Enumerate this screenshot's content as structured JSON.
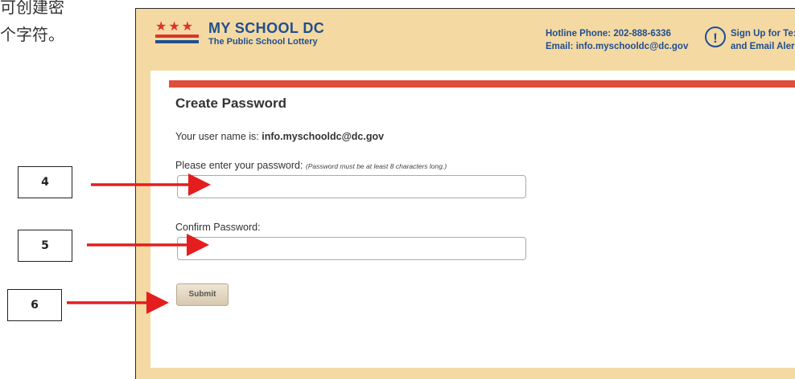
{
  "document": {
    "text_lines": [
      "可创建密",
      "个字符。"
    ]
  },
  "header": {
    "logo_title": "MY SCHOOL DC",
    "logo_subtitle": "The Public School Lottery",
    "hotline": "Hotline Phone: 202-888-6336",
    "email_line": "Email: info.myschooldc@dc.gov",
    "signup_line1": "Sign Up for Te:",
    "signup_line2": "and Email Aler",
    "alert_icon": "exclamation-circle-icon"
  },
  "form": {
    "title": "Create Password",
    "username_prefix": "Your user name is:",
    "username_value": "info.myschooldc@dc.gov",
    "password_label": "Please enter your password:",
    "password_hint": "(Password must be at least 8 characters long.)",
    "password_value": "",
    "confirm_label": "Confirm Password:",
    "confirm_value": "",
    "submit_label": "Submit"
  },
  "annotations": [
    {
      "label": "4"
    },
    {
      "label": "5"
    },
    {
      "label": "6"
    }
  ],
  "colors": {
    "accent_red": "#e04d3a",
    "brand_blue": "#1f4f8f",
    "header_bg": "#f5d9a3",
    "arrow_red": "#e41e1e"
  }
}
